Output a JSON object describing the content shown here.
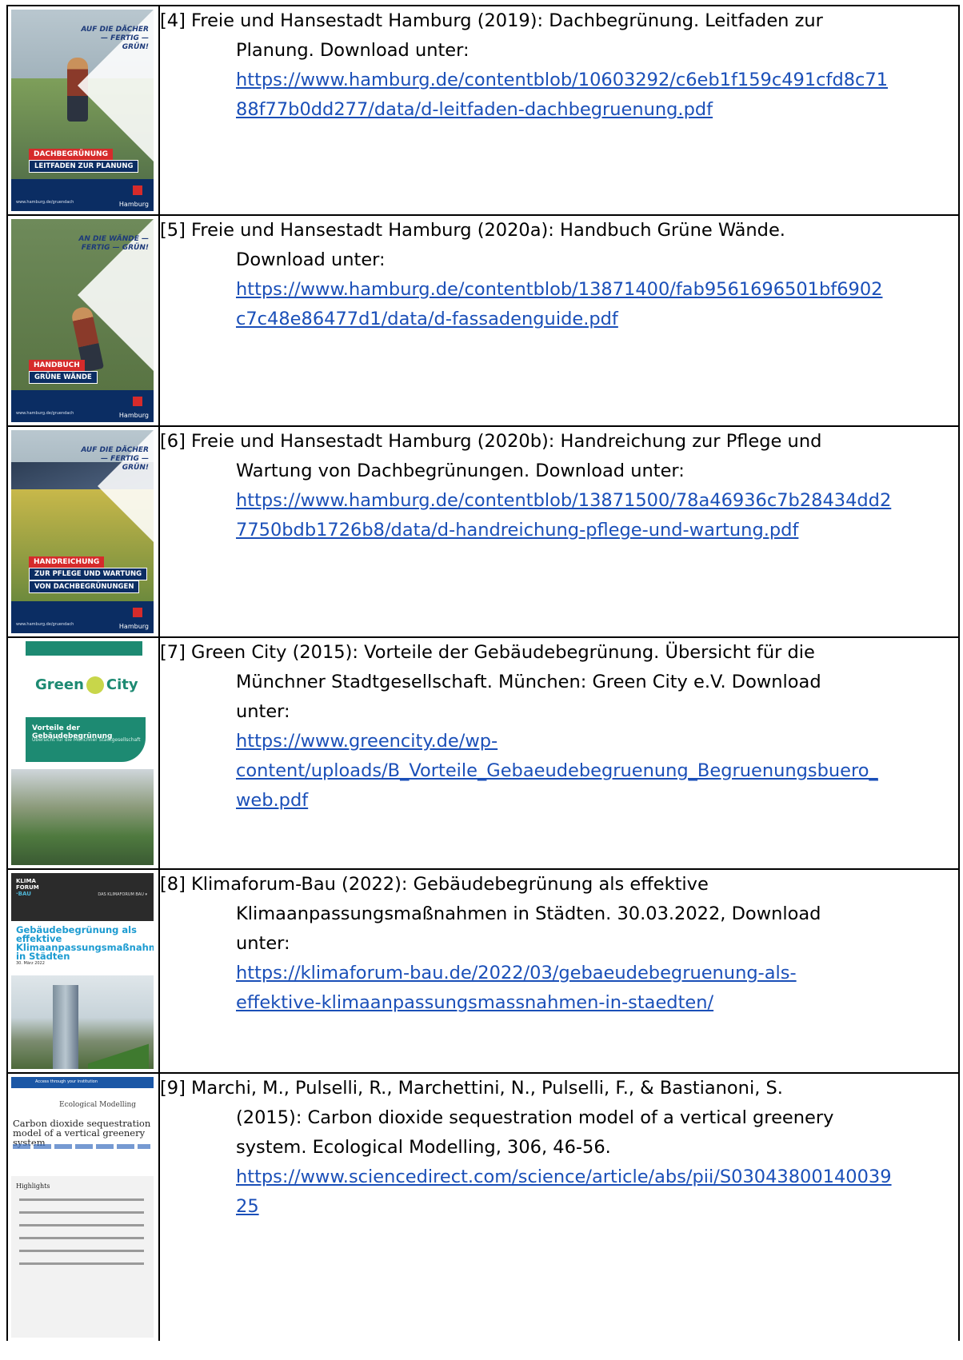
{
  "references": [
    {
      "first_line": "[4] Freie und Hansestadt Hamburg (2019): Dachbegrünung. Leitfaden zur",
      "lines": [
        "Planung. Download unter:"
      ],
      "url_lines": [
        "https://www.hamburg.de/contentblob/10603292/c6eb1f159c491cfd8c71",
        "88f77b0dd277/data/d-leitfaden-dachbegruenung.pdf"
      ],
      "cover": {
        "slogan": "AUF DIE DÄCHER — FERTIG — GRÜN!",
        "label_red": "DACHBEGRÜNUNG",
        "label_blue": "LEITFADEN ZUR PLANUNG",
        "footer_url": "www.hamburg.de/gruendach",
        "city": "Hamburg"
      }
    },
    {
      "first_line": "[5] Freie und Hansestadt Hamburg (2020a): Handbuch Grüne Wände.",
      "lines": [
        "Download unter:"
      ],
      "url_lines": [
        "https://www.hamburg.de/contentblob/13871400/fab9561696501bf6902",
        "c7c48e86477d1/data/d-fassadenguide.pdf"
      ],
      "cover": {
        "slogan": "AN DIE WÄNDE — FERTIG — GRÜN!",
        "label_red": "HANDBUCH",
        "label_blue": "GRÜNE WÄNDE",
        "footer_url": "www.hamburg.de/gruendach",
        "city": "Hamburg"
      }
    },
    {
      "first_line": "[6] Freie und Hansestadt Hamburg (2020b): Handreichung zur Pflege und",
      "lines": [
        "Wartung von Dachbegrünungen. Download unter:"
      ],
      "url_lines": [
        "https://www.hamburg.de/contentblob/13871500/78a46936c7b28434dd2",
        "7750bdb1726b8/data/d-handreichung-pflege-und-wartung.pdf"
      ],
      "cover": {
        "slogan": "AUF DIE DÄCHER — FERTIG — GRÜN!",
        "label_red": "HANDREICHUNG",
        "label_blue": "ZUR PFLEGE UND WARTUNG",
        "label_blue2": "VON DACHBEGRÜNUNGEN",
        "footer_url": "www.hamburg.de/gruendach",
        "city": "Hamburg"
      }
    },
    {
      "first_line": "[7] Green City (2015): Vorteile der Gebäudebegrünung. Übersicht für die",
      "lines": [
        "Münchner Stadtgesellschaft. München: Green City e.V. Download",
        "unter:"
      ],
      "url_lines": [
        "https://www.greencity.de/wp-",
        "content/uploads/B_Vorteile_Gebaeudebegruenung_Begruenungsbuero_",
        "web.pdf"
      ],
      "cover": {
        "logo_left": "Green",
        "logo_right": "City",
        "banner_title": "Vorteile der Gebäudebegrünung",
        "banner_sub": "Übersicht für die Münchner Stadtgesellschaft"
      }
    },
    {
      "first_line": "[8] Klimaforum-Bau (2022): Gebäudebegrünung als effektive",
      "lines": [
        "Klimaanpassungsmaßnahmen in Städten. 30.03.2022, Download",
        "unter:"
      ],
      "url_lines": [
        " https://klimaforum-bau.de/2022/03/gebaeudebegruenung-als-",
        "effektive-klimaanpassungsmassnahmen-in-staedten/"
      ],
      "cover": {
        "brand1": "KLIMA",
        "brand2": "FORUM",
        "brand3": "·BAU",
        "nav": "DAS KLIMAFORUM BAU ▾",
        "title": "Gebäudebegrünung als effektive Klimaanpassungsmaßnahmen in Städten",
        "date": "30. März 2022"
      }
    },
    {
      "first_line": "[9] Marchi, M., Pulselli, R., Marchettini, N., Pulselli, F., & Bastianoni, S.",
      "lines": [
        "(2015): Carbon dioxide sequestration model of a vertical greenery",
        "system. Ecological Modelling, 306, 46-56."
      ],
      "url_lines": [
        "https://www.sciencedirect.com/science/article/abs/pii/S03043800140039",
        "25"
      ],
      "cover": {
        "bar": "Access through your institution",
        "journal": "Ecological Modelling",
        "title": "Carbon dioxide sequestration model of a vertical greenery system",
        "highlights": "Highlights"
      }
    }
  ]
}
